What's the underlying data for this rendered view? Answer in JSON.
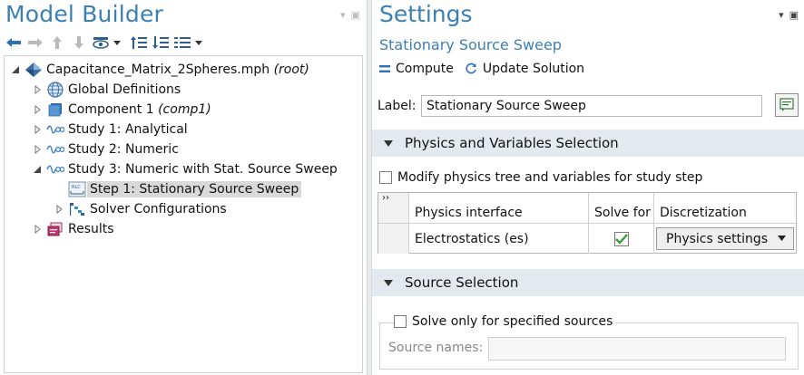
{
  "model_builder": {
    "title": "Model Builder",
    "tree": [
      {
        "label": "Capacitance_Matrix_2Spheres.mph",
        "suffix": "(root)",
        "icon": "root-model-icon",
        "expander": "expanded",
        "level": 0
      },
      {
        "label": "Global Definitions",
        "suffix": "",
        "icon": "globe-icon",
        "expander": "collapsed",
        "level": 1
      },
      {
        "label": "Component 1",
        "suffix": "(comp1)",
        "icon": "component-icon",
        "expander": "collapsed",
        "level": 1
      },
      {
        "label": "Study 1: Analytical",
        "suffix": "",
        "icon": "study-icon",
        "expander": "collapsed",
        "level": 1
      },
      {
        "label": "Study 2: Numeric",
        "suffix": "",
        "icon": "study-icon",
        "expander": "collapsed",
        "level": 1
      },
      {
        "label": "Study 3: Numeric with Stat. Source Sweep",
        "suffix": "",
        "icon": "study-icon",
        "expander": "expanded",
        "level": 1
      },
      {
        "label": "Step 1: Stationary Source Sweep",
        "suffix": "",
        "icon": "stationary-source-sweep-icon",
        "expander": "none",
        "level": 2,
        "selected": true
      },
      {
        "label": "Solver Configurations",
        "suffix": "",
        "icon": "solver-configurations-icon",
        "expander": "collapsed",
        "level": 2
      },
      {
        "label": "Results",
        "suffix": "",
        "icon": "results-icon",
        "expander": "collapsed",
        "level": 1
      }
    ]
  },
  "settings": {
    "title": "Settings",
    "subtitle": "Stationary Source Sweep",
    "compute_label": "Compute",
    "update_label": "Update Solution",
    "label_text": "Label:",
    "label_value": "Stationary Source Sweep",
    "physics_section_title": "Physics and Variables Selection",
    "modify_checkbox_label": "Modify physics tree and variables for study step",
    "modify_checked": false,
    "table": {
      "gutter_mark": "››",
      "columns": [
        "Physics interface",
        "Solve for",
        "Discretization"
      ],
      "rows": [
        {
          "physics_interface": "Electrostatics (es)",
          "solve_for": true,
          "discretization": "Physics settings"
        }
      ]
    },
    "source_section_title": "Source Selection",
    "solve_only_label": "Solve only for specified sources",
    "solve_only_checked": false,
    "source_names_label": "Source names:",
    "source_names_value": ""
  },
  "colors": {
    "title_blue": "#3c7fb1",
    "section_bg": "#e4e9ef",
    "selected_bg": "#d9d9d9",
    "check_green": "#3a9a3a"
  }
}
